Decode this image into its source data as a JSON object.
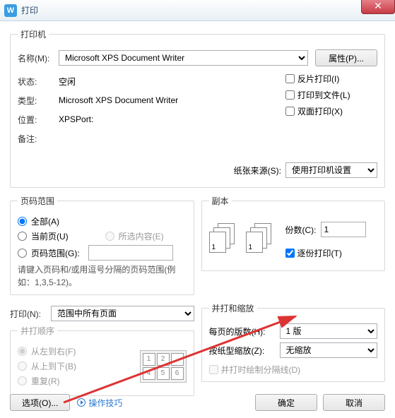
{
  "title": "打印",
  "printer": {
    "section": "打印机",
    "name_label": "名称(M):",
    "name_value": "Microsoft XPS Document Writer",
    "properties_btn": "属性(P)...",
    "status_label": "状态:",
    "status_value": "空闲",
    "type_label": "类型:",
    "type_value": "Microsoft XPS Document Writer",
    "location_label": "位置:",
    "location_value": "XPSPort:",
    "comment_label": "备注:",
    "comment_value": "",
    "reverse_print": "反片打印(I)",
    "print_to_file": "打印到文件(L)",
    "duplex": "双面打印(X)",
    "paper_source_label": "纸张来源(S):",
    "paper_source_value": "使用打印机设置"
  },
  "range": {
    "section": "页码范围",
    "all": "全部(A)",
    "current": "当前页(U)",
    "selection": "所选内容(E)",
    "pages": "页码范围(G):",
    "hint": "请键入页码和/或用逗号分隔的页码范围(例如：1,3,5-12)。",
    "pages_value": ""
  },
  "copies": {
    "section": "副本",
    "count_label": "份数(C):",
    "count_value": "1",
    "collate": "逐份打印(T)"
  },
  "print_what": {
    "label": "打印(N):",
    "value": "范围中所有页面"
  },
  "order": {
    "section": "并打顺序",
    "ltr": "从左到右(F)",
    "ttb": "从上到下(B)",
    "repeat": "重复(R)",
    "cells": [
      "1",
      "2",
      "",
      "4",
      "5",
      "6"
    ]
  },
  "scale": {
    "section": "并打和缩放",
    "per_sheet_label": "每页的版数(H):",
    "per_sheet_value": "1 版",
    "scale_label": "按纸型缩放(Z):",
    "scale_value": "无缩放",
    "draw_lines": "并打时绘制分隔线(D)"
  },
  "footer": {
    "options_btn": "选项(O)...",
    "tips": "操作技巧",
    "ok": "确定",
    "cancel": "取消"
  }
}
